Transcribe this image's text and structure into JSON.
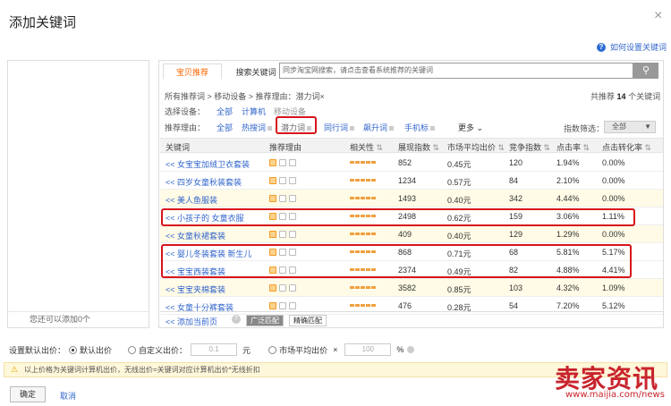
{
  "dialog": {
    "title": "添加关键词",
    "help_text": "如何设置关键词"
  },
  "left_panel": {
    "footer": "您还可以添加0个"
  },
  "tabs": [
    {
      "label": "宝贝推荐"
    },
    {
      "label": "搜索关键词"
    }
  ],
  "search": {
    "placeholder": "同步淘宝网搜索，请点击查看系统推荐的关键词"
  },
  "breadcrumb": "所有推荐词 > 移动设备 > 推荐理由：潜力词×",
  "total": {
    "prefix": "共推荐",
    "count": "14",
    "suffix": "个关键词"
  },
  "device": {
    "label": "选择设备：",
    "options": [
      "全部",
      "计算机",
      "移动设备"
    ]
  },
  "reasons": {
    "label": "推荐理由：",
    "options": [
      "全部",
      "热搜词",
      "潜力词",
      "同行词",
      "飙升词",
      "手机标"
    ],
    "more": "更多",
    "index_label": "指数筛选：",
    "index_value": "全部"
  },
  "columns": [
    "关键词",
    "推荐理由",
    "相关性",
    "展现指数",
    "市场平均出价",
    "竞争指数",
    "点击率",
    "点击转化率"
  ],
  "rows": [
    {
      "kw": "<< 女宝宝加绒卫衣套装",
      "rel": 5,
      "impr": "852",
      "bid": "0.45元",
      "comp": "120",
      "ctr": "1.94%",
      "cvr": "0.00%"
    },
    {
      "kw": "<< 四岁女童秋装套装",
      "rel": 5,
      "impr": "1234",
      "bid": "0.57元",
      "comp": "84",
      "ctr": "2.10%",
      "cvr": "0.00%"
    },
    {
      "kw": "<< 美人鱼服装",
      "rel": 5,
      "impr": "1493",
      "bid": "0.40元",
      "comp": "342",
      "ctr": "4.44%",
      "cvr": "0.00%"
    },
    {
      "kw": "<< 小孩子的 女童衣服",
      "rel": 5,
      "impr": "2498",
      "bid": "0.62元",
      "comp": "159",
      "ctr": "3.06%",
      "cvr": "1.11%"
    },
    {
      "kw": "<< 女童秋裙套装",
      "rel": 5,
      "impr": "409",
      "bid": "0.40元",
      "comp": "129",
      "ctr": "1.29%",
      "cvr": "0.00%"
    },
    {
      "kw": "<< 婴儿冬装套装 新生儿",
      "rel": 5,
      "impr": "868",
      "bid": "0.71元",
      "comp": "68",
      "ctr": "5.81%",
      "cvr": "5.17%"
    },
    {
      "kw": "<< 宝宝西装套装",
      "rel": 5,
      "impr": "2374",
      "bid": "0.49元",
      "comp": "82",
      "ctr": "4.88%",
      "cvr": "4.41%"
    },
    {
      "kw": "<< 宝宝夹棉套装",
      "rel": 5,
      "impr": "3582",
      "bid": "0.85元",
      "comp": "103",
      "ctr": "4.32%",
      "cvr": "1.09%"
    },
    {
      "kw": "<< 女童十分裤套装",
      "rel": 5,
      "impr": "476",
      "bid": "0.28元",
      "comp": "54",
      "ctr": "7.20%",
      "cvr": "5.12%"
    }
  ],
  "footer": {
    "add_page": "<< 添加当前页",
    "broad": "广泛匹配",
    "exact": "精确匹配"
  },
  "default_bid": {
    "label": "设置默认出价：",
    "default": "默认出价",
    "custom": "自定义出价：",
    "custom_value": "0.1",
    "unit": "元",
    "market": "市场平均出价",
    "times": "×",
    "pct_value": "100",
    "pct": "%"
  },
  "notice": "以上价格为关键词计算机出价，无线出价=关键词对应计算机出价*无线折扣",
  "buttons": {
    "ok": "确定",
    "cancel": "取消"
  },
  "watermark": {
    "text": "卖家资讯",
    "url": "www.maijia.com/news"
  }
}
